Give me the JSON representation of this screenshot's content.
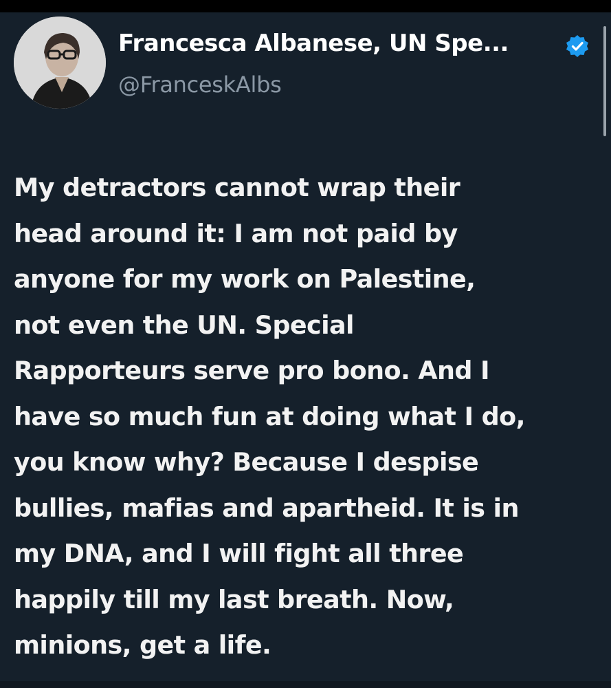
{
  "author": {
    "display_name": "Francesca Albanese, UN Spe...",
    "handle": "@FranceskAlbs",
    "verified": true,
    "avatar_icon": "profile-photo",
    "verified_icon": "verified-badge-icon"
  },
  "tweet": {
    "lines": [
      "My detractors cannot wrap their",
      "head around it: I am not paid by",
      "anyone for my work on Palestine,",
      "not even the UN. Special",
      "Rapporteurs serve pro bono. And I",
      "have so much fun at doing what I do,",
      "you know why? Because I despise",
      "bullies, mafias and apartheid. It is in",
      "my DNA, and I will fight all three",
      "happily till my last breath. Now,",
      "minions, get a life."
    ]
  },
  "colors": {
    "background": "#15202b",
    "text": "#f2f2f2",
    "handle": "#8b98a5",
    "verified": "#1d9bf0"
  }
}
